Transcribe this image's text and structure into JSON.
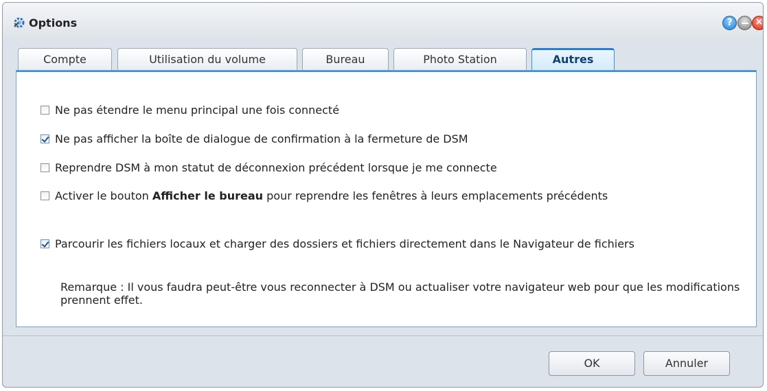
{
  "window": {
    "title": "Options"
  },
  "tabs": [
    {
      "label": "Compte"
    },
    {
      "label": "Utilisation du volume"
    },
    {
      "label": "Bureau"
    },
    {
      "label": "Photo Station"
    },
    {
      "label": "Autres",
      "active": true
    }
  ],
  "options": [
    {
      "label": "Ne pas étendre le menu principal une fois connecté",
      "checked": false
    },
    {
      "label": "Ne pas afficher la boîte de dialogue de confirmation à la fermeture de DSM",
      "checked": true
    },
    {
      "label": "Reprendre DSM à mon statut de déconnexion précédent lorsque je me connecte",
      "checked": false
    },
    {
      "label_before": "Activer le bouton",
      "label_bold": "Afficher le bureau",
      "label_after": "pour reprendre les fenêtres à leurs emplacements précédents",
      "checked": false
    },
    {
      "label": "Parcourir les fichiers locaux et charger des dossiers et fichiers directement dans le Navigateur de fichiers",
      "checked": true
    }
  ],
  "note": "Remarque : Il vous faudra peut-être vous reconnecter à DSM ou actualiser votre navigateur web pour que les modifications prennent effet.",
  "footer": {
    "ok_label": "OK",
    "cancel_label": "Annuler"
  },
  "controls": {
    "help_glyph": "?",
    "close_glyph": "×"
  },
  "colors": {
    "accent": "#2a7dd0",
    "tab_active_text": "#13406e"
  }
}
